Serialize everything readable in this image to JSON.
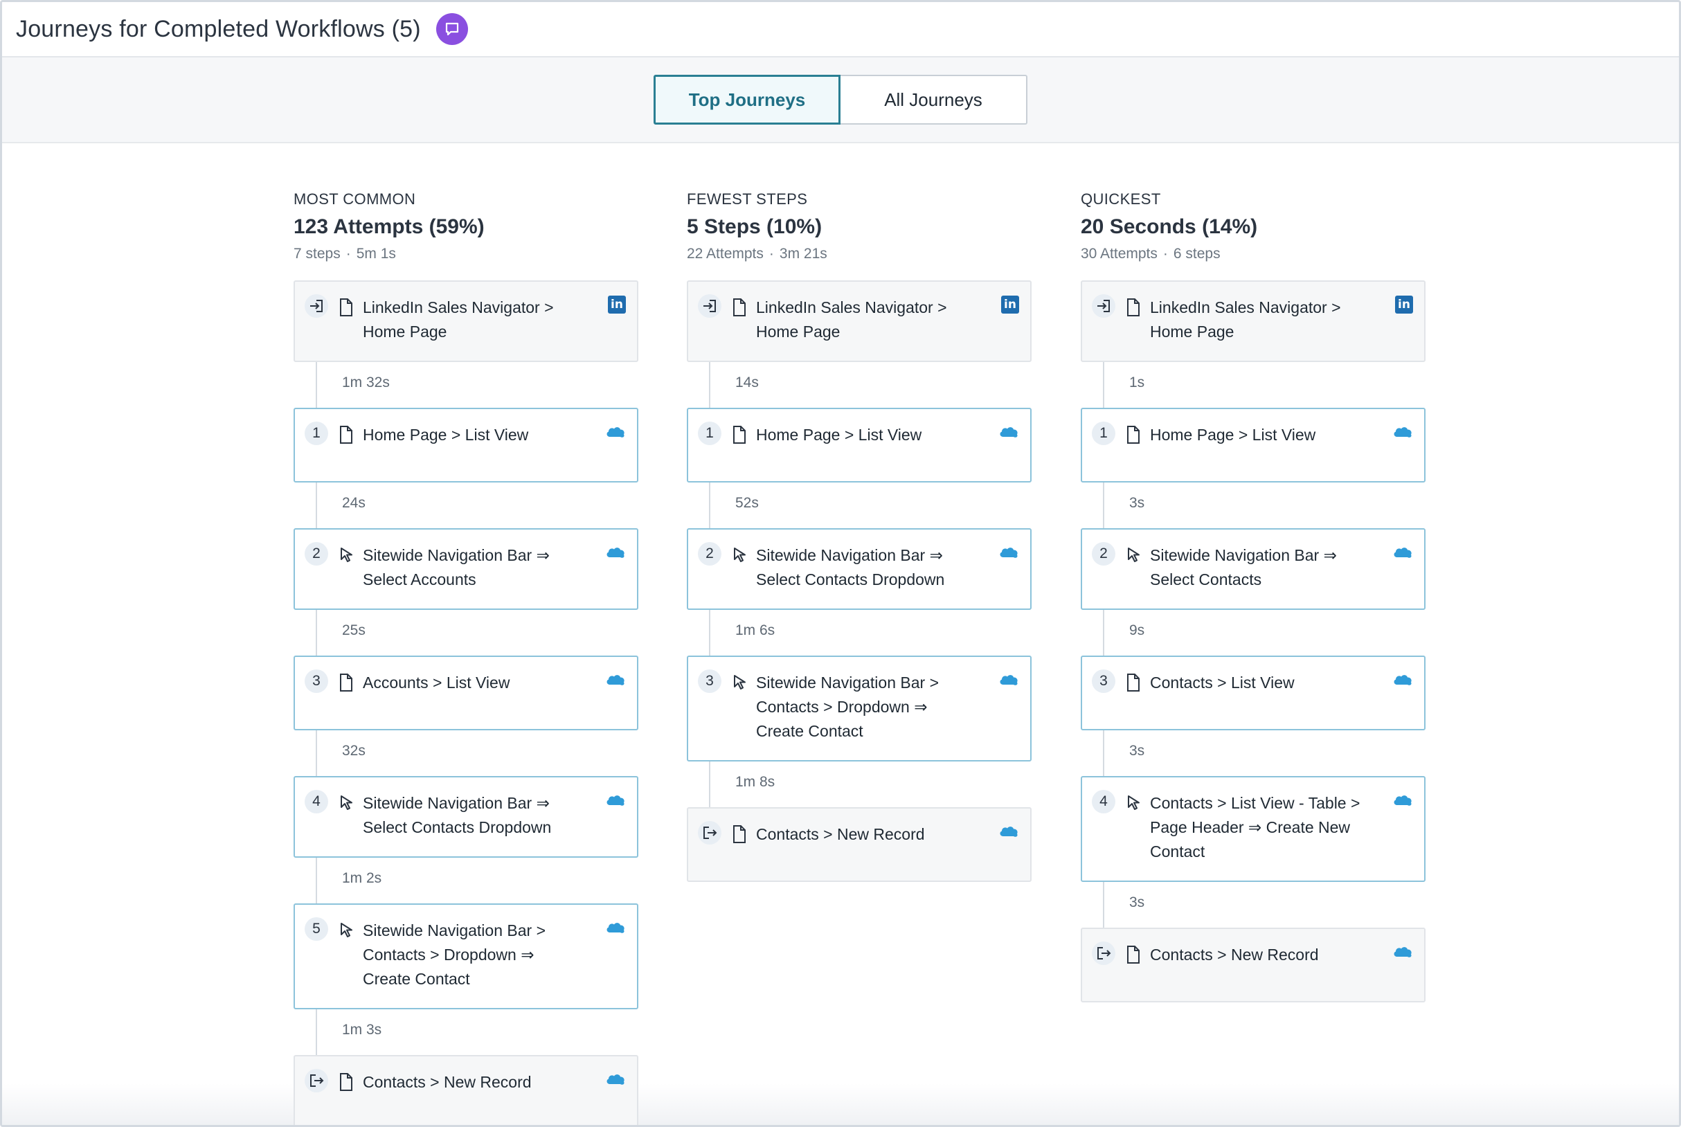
{
  "header": {
    "title": "Journeys for Completed Workflows (5)"
  },
  "tabs": [
    {
      "label": "Top Journeys",
      "active": true
    },
    {
      "label": "All Journeys",
      "active": false
    }
  ],
  "columns": [
    {
      "kicker": "MOST COMMON",
      "title": "123 Attempts (59%)",
      "meta": [
        "7 steps",
        "5m 1s"
      ],
      "steps": [
        {
          "kind": "entry",
          "type": "page",
          "app": "linkedin",
          "lines": [
            "LinkedIn Sales Navigator >",
            "Home Page"
          ],
          "duration_after": "1m 32s"
        },
        {
          "kind": "step",
          "number": "1",
          "type": "page",
          "app": "salesforce",
          "lines": [
            "Home Page > List View"
          ],
          "duration_after": "24s"
        },
        {
          "kind": "step",
          "number": "2",
          "type": "click",
          "app": "salesforce",
          "lines": [
            "Sitewide Navigation Bar ⇒",
            "Select Accounts"
          ],
          "duration_after": "25s"
        },
        {
          "kind": "step",
          "number": "3",
          "type": "page",
          "app": "salesforce",
          "lines": [
            "Accounts > List View"
          ],
          "duration_after": "32s"
        },
        {
          "kind": "step",
          "number": "4",
          "type": "click",
          "app": "salesforce",
          "lines": [
            "Sitewide Navigation Bar ⇒",
            "Select Contacts Dropdown"
          ],
          "duration_after": "1m 2s"
        },
        {
          "kind": "step",
          "number": "5",
          "type": "click",
          "app": "salesforce",
          "lines": [
            "Sitewide Navigation Bar >",
            "Contacts > Dropdown ⇒",
            "Create Contact"
          ],
          "duration_after": "1m 3s"
        },
        {
          "kind": "exit",
          "type": "page",
          "app": "salesforce",
          "lines": [
            "Contacts > New Record"
          ]
        }
      ]
    },
    {
      "kicker": "FEWEST STEPS",
      "title": "5 Steps (10%)",
      "meta": [
        "22 Attempts",
        "3m 21s"
      ],
      "steps": [
        {
          "kind": "entry",
          "type": "page",
          "app": "linkedin",
          "lines": [
            "LinkedIn Sales Navigator >",
            "Home Page"
          ],
          "duration_after": "14s"
        },
        {
          "kind": "step",
          "number": "1",
          "type": "page",
          "app": "salesforce",
          "lines": [
            "Home Page > List View"
          ],
          "duration_after": "52s"
        },
        {
          "kind": "step",
          "number": "2",
          "type": "click",
          "app": "salesforce",
          "lines": [
            "Sitewide Navigation Bar ⇒",
            "Select Contacts Dropdown"
          ],
          "duration_after": "1m 6s"
        },
        {
          "kind": "step",
          "number": "3",
          "type": "click",
          "app": "salesforce",
          "lines": [
            "Sitewide Navigation Bar >",
            "Contacts > Dropdown ⇒",
            "Create Contact"
          ],
          "duration_after": "1m 8s"
        },
        {
          "kind": "exit",
          "type": "page",
          "app": "salesforce",
          "lines": [
            "Contacts > New Record"
          ]
        }
      ]
    },
    {
      "kicker": "QUICKEST",
      "title": "20 Seconds (14%)",
      "meta": [
        "30 Attempts",
        "6 steps"
      ],
      "steps": [
        {
          "kind": "entry",
          "type": "page",
          "app": "linkedin",
          "lines": [
            "LinkedIn Sales Navigator >",
            "Home Page"
          ],
          "duration_after": "1s"
        },
        {
          "kind": "step",
          "number": "1",
          "type": "page",
          "app": "salesforce",
          "lines": [
            "Home Page > List View"
          ],
          "duration_after": "3s"
        },
        {
          "kind": "step",
          "number": "2",
          "type": "click",
          "app": "salesforce",
          "lines": [
            "Sitewide Navigation Bar ⇒",
            "Select Contacts"
          ],
          "duration_after": "9s"
        },
        {
          "kind": "step",
          "number": "3",
          "type": "page",
          "app": "salesforce",
          "lines": [
            "Contacts > List View"
          ],
          "duration_after": "3s"
        },
        {
          "kind": "step",
          "number": "4",
          "type": "click",
          "app": "salesforce",
          "lines": [
            "Contacts > List View - Table >",
            "Page Header ⇒ Create New",
            "Contact"
          ],
          "duration_after": "3s"
        },
        {
          "kind": "exit",
          "type": "page",
          "app": "salesforce",
          "lines": [
            "Contacts > New Record"
          ]
        }
      ]
    }
  ],
  "colors": {
    "accent": "#2a7f93",
    "card_border": "#8cc3db",
    "chat_badge": "#8a4fe0",
    "salesforce": "#2f9bd8",
    "linkedin": "#1f6cae"
  },
  "icons": {
    "chat": "chat-bubble-icon",
    "entry": "sign-in-icon",
    "exit": "sign-out-icon",
    "page": "page-icon",
    "click": "cursor-click-icon",
    "linkedin": "linkedin-icon",
    "salesforce": "salesforce-cloud-icon"
  }
}
